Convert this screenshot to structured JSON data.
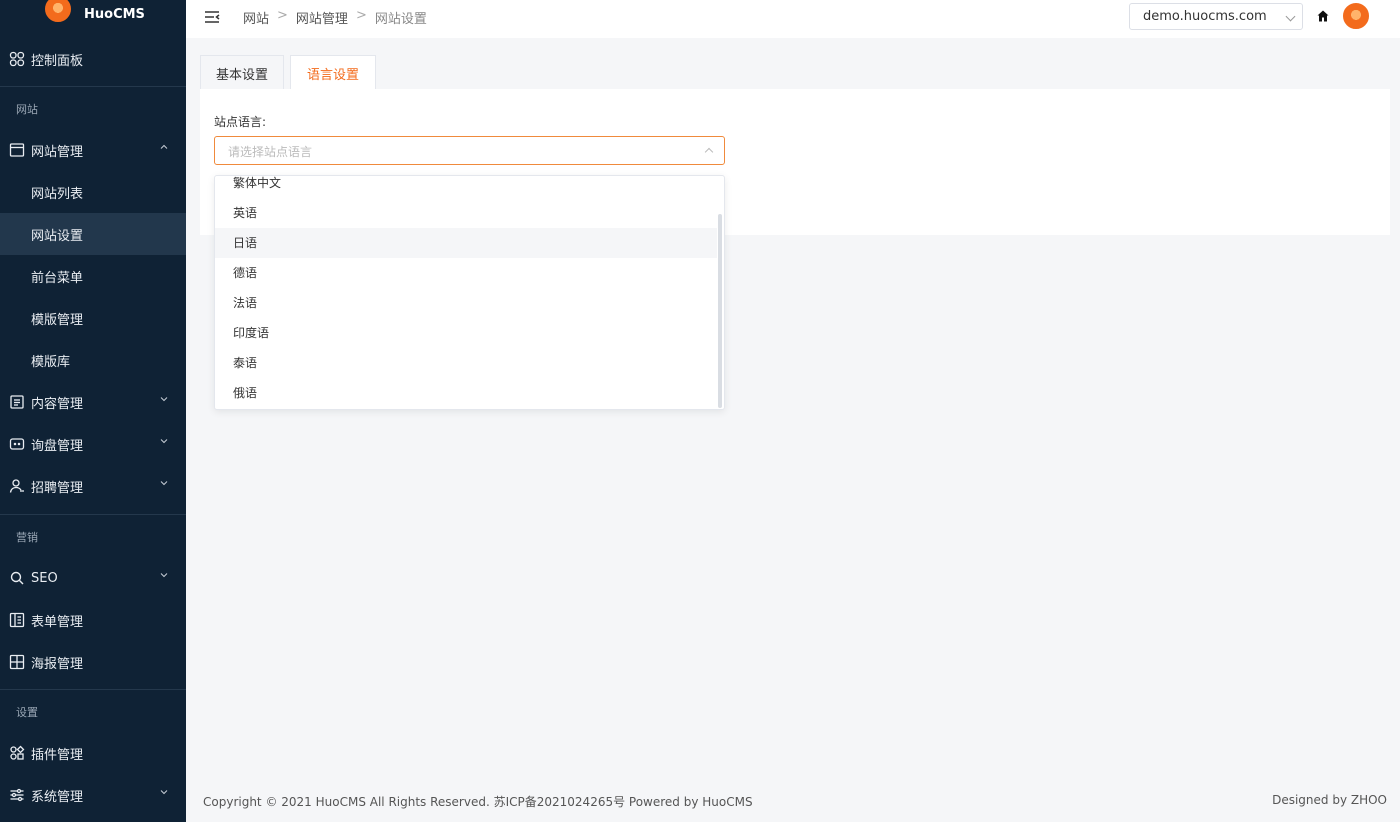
{
  "app": {
    "name": "HuoCMS"
  },
  "sidebar": {
    "dashboard": "控制面板",
    "group_site": "网站",
    "site_manage": "网站管理",
    "site_list": "网站列表",
    "site_settings": "网站设置",
    "front_menu": "前台菜单",
    "template_manage": "模版管理",
    "template_lib": "模版库",
    "content_manage": "内容管理",
    "inquiry_manage": "询盘管理",
    "recruit_manage": "招聘管理",
    "group_marketing": "营销",
    "seo": "SEO",
    "form_manage": "表单管理",
    "poster_manage": "海报管理",
    "group_settings": "设置",
    "plugin_manage": "插件管理",
    "system_manage": "系统管理"
  },
  "breadcrumb": {
    "level1": "网站",
    "level2": "网站管理",
    "level3": "网站设置",
    "separator": ">"
  },
  "topbar": {
    "domain": "demo.huocms.com"
  },
  "tabs": {
    "basic": "基本设置",
    "language": "语言设置"
  },
  "form": {
    "label": "站点语言:",
    "placeholder": "请选择站点语言"
  },
  "dropdown": {
    "options": [
      "繁体中文",
      "英语",
      "日语",
      "德语",
      "法语",
      "印度语",
      "泰语",
      "俄语"
    ],
    "hovered": "日语"
  },
  "footer": {
    "copyright": "Copyright © 2021 HuoCMS All Rights Reserved. 苏ICP备2021024265号 Powered by HuoCMS",
    "designed": "Designed by ZHOO"
  },
  "colors": {
    "accent": "#f36b1c",
    "sidebar_bg": "#0f2235",
    "sidebar_active": "#22374c"
  }
}
